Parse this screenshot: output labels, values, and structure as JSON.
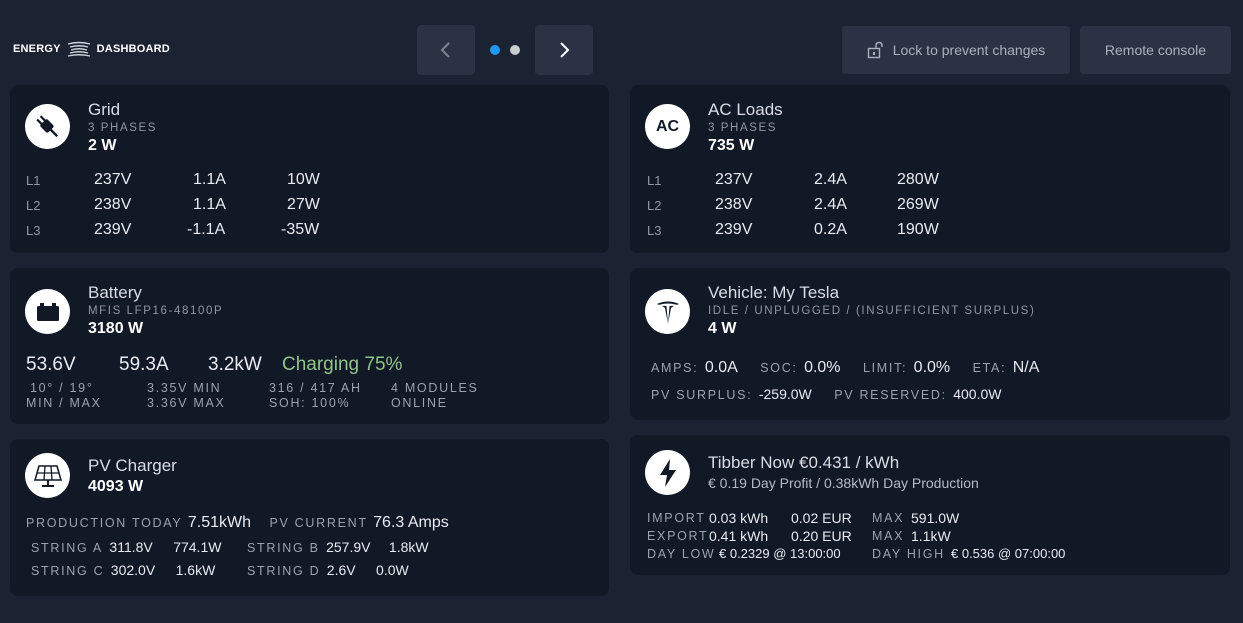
{
  "header": {
    "logo_left": "ENERGY",
    "logo_right": "DASHBOARD",
    "lock_label": "Lock to prevent changes",
    "remote_label": "Remote console",
    "page_dots": 2,
    "active_dot": 0
  },
  "colors": {
    "background": "#1b2232",
    "card": "#111826",
    "button": "#2a3244",
    "dot_active": "#2196f3",
    "dot_inactive": "#c8cbd0",
    "charging_green": "#8fc48a"
  },
  "grid": {
    "icon": "plug-icon",
    "title": "Grid",
    "subtitle": "3 PHASES",
    "power": "2 W",
    "phases": [
      {
        "label": "L1",
        "voltage": "237V",
        "current": "1.1A",
        "power": "10W"
      },
      {
        "label": "L2",
        "voltage": "238V",
        "current": "1.1A",
        "power": "27W"
      },
      {
        "label": "L3",
        "voltage": "239V",
        "current": "-1.1A",
        "power": "-35W"
      }
    ]
  },
  "ac_loads": {
    "icon": "ac-icon",
    "icon_text": "AC",
    "title": "AC Loads",
    "subtitle": "3 PHASES",
    "power": "735 W",
    "phases": [
      {
        "label": "L1",
        "voltage": "237V",
        "current": "2.4A",
        "power": "280W"
      },
      {
        "label": "L2",
        "voltage": "238V",
        "current": "2.4A",
        "power": "269W"
      },
      {
        "label": "L3",
        "voltage": "239V",
        "current": "0.2A",
        "power": "190W"
      }
    ]
  },
  "battery": {
    "icon": "battery-icon",
    "title": "Battery",
    "subtitle": "MFIS LFP16-48100P",
    "power": "3180 W",
    "voltage": "53.6V",
    "current": "59.3A",
    "kw": "3.2kW",
    "state": "Charging",
    "soc": "75%",
    "temp": "10° / 19°",
    "temp_label": "MIN / MAX",
    "cell_min": "3.35V MIN",
    "cell_max": "3.36V MAX",
    "capacity": "316 / 417 AH",
    "soh": "SOH: 100%",
    "modules": "4 MODULES",
    "modules_state": "ONLINE"
  },
  "vehicle": {
    "icon": "tesla-icon",
    "title": "Vehicle: My Tesla",
    "subtitle": "IDLE / UNPLUGGED / (INSUFFICIENT SURPLUS)",
    "power": "4 W",
    "amps_label": "AMPS:",
    "amps": "0.0A",
    "soc_label": "SOC:",
    "soc": "0.0%",
    "limit_label": "LIMIT:",
    "limit": "0.0%",
    "eta_label": "ETA:",
    "eta": "N/A",
    "pv_surplus_label": "PV SURPLUS:",
    "pv_surplus": "-259.0W",
    "pv_reserved_label": "PV RESERVED:",
    "pv_reserved": "400.0W"
  },
  "pv_charger": {
    "icon": "solar-panel-icon",
    "title": "PV Charger",
    "power": "4093 W",
    "production_label": "PRODUCTION TODAY",
    "production": "7.51kWh",
    "pv_current_label": "PV CURRENT",
    "pv_current": "76.3 Amps",
    "strings": [
      {
        "label": "STRING A",
        "voltage": "311.8V",
        "power": "774.1W"
      },
      {
        "label": "STRING B",
        "voltage": "257.9V",
        "power": "1.8kW"
      },
      {
        "label": "STRING C",
        "voltage": "302.0V",
        "power": "1.6kW"
      },
      {
        "label": "STRING D",
        "voltage": "2.6V",
        "power": "0.0W"
      }
    ]
  },
  "tibber": {
    "icon": "lightning-icon",
    "title": "Tibber Now €0.431 / kWh",
    "subtitle": "€ 0.19 Day Profit / 0.38kWh Day Production",
    "import_label": "IMPORT",
    "import_kwh": "0.03 kWh",
    "import_eur": "0.02 EUR",
    "import_max_label": "MAX",
    "import_max": "591.0W",
    "export_label": "EXPORT",
    "export_kwh": "0.41 kWh",
    "export_eur": "0.20 EUR",
    "export_max_label": "MAX",
    "export_max": "1.1kW",
    "day_low_label": "DAY LOW",
    "day_low": "€ 0.2329 @ 13:00:00",
    "day_high_label": "DAY HIGH",
    "day_high": "€ 0.536 @ 07:00:00"
  }
}
